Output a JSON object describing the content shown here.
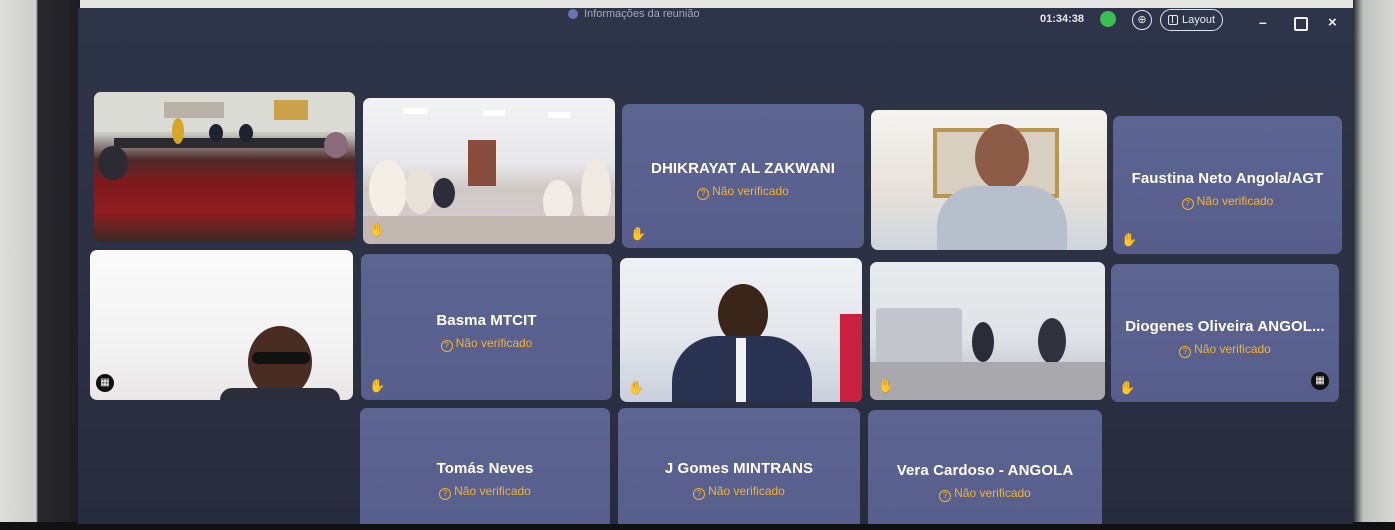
{
  "topbar": {
    "meeting_info": "Informações da reunião",
    "timer": "01:34:38",
    "layout_label": "Layout",
    "minimize": "–",
    "close": "×"
  },
  "icons": {
    "raise_hand": "raise-hand-icon",
    "grid": "grid-icon",
    "unverified": "unverified-icon"
  },
  "colors": {
    "background": "#2b3143",
    "tile": "#5b6290",
    "unverified_text": "#f1b431",
    "recording": "#3bbf52"
  },
  "participants": [
    {
      "name": "DHIKRAYAT AL ZAKWANI",
      "status": "Não verificado"
    },
    {
      "name": "Faustina Neto Angola/AGT",
      "status": "Não verificado"
    },
    {
      "name": "Basma MTCIT",
      "status": "Não verificado"
    },
    {
      "name": "Diogenes Oliveira ANGOL...",
      "status": "Não verificado"
    },
    {
      "name": "Tomás Neves",
      "status": "Não verificado"
    },
    {
      "name": "J Gomes MINTRANS",
      "status": "Não verificado"
    },
    {
      "name": "Vera Cardoso - ANGOLA",
      "status": "Não verificado"
    }
  ]
}
